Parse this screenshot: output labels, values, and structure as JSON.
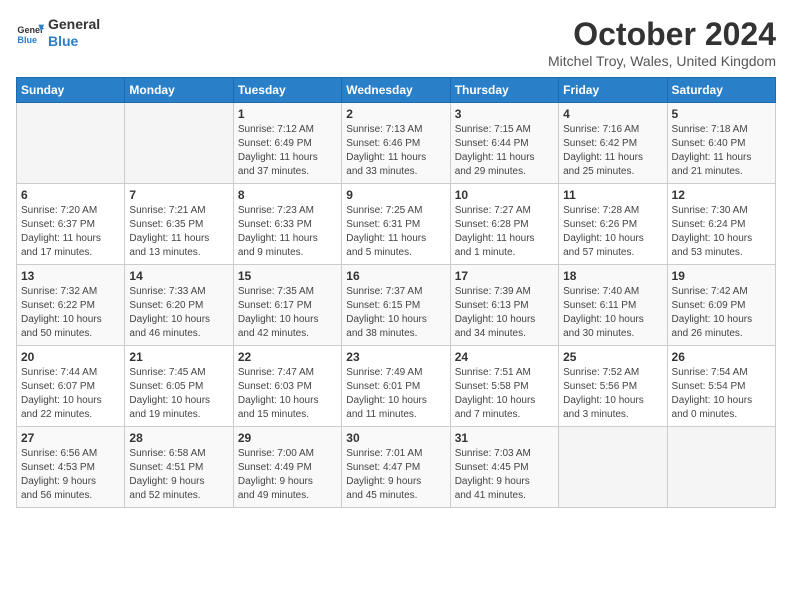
{
  "logo": {
    "line1": "General",
    "line2": "Blue"
  },
  "title": "October 2024",
  "subtitle": "Mitchel Troy, Wales, United Kingdom",
  "weekdays": [
    "Sunday",
    "Monday",
    "Tuesday",
    "Wednesday",
    "Thursday",
    "Friday",
    "Saturday"
  ],
  "weeks": [
    [
      {
        "day": "",
        "info": ""
      },
      {
        "day": "",
        "info": ""
      },
      {
        "day": "1",
        "info": "Sunrise: 7:12 AM\nSunset: 6:49 PM\nDaylight: 11 hours\nand 37 minutes."
      },
      {
        "day": "2",
        "info": "Sunrise: 7:13 AM\nSunset: 6:46 PM\nDaylight: 11 hours\nand 33 minutes."
      },
      {
        "day": "3",
        "info": "Sunrise: 7:15 AM\nSunset: 6:44 PM\nDaylight: 11 hours\nand 29 minutes."
      },
      {
        "day": "4",
        "info": "Sunrise: 7:16 AM\nSunset: 6:42 PM\nDaylight: 11 hours\nand 25 minutes."
      },
      {
        "day": "5",
        "info": "Sunrise: 7:18 AM\nSunset: 6:40 PM\nDaylight: 11 hours\nand 21 minutes."
      }
    ],
    [
      {
        "day": "6",
        "info": "Sunrise: 7:20 AM\nSunset: 6:37 PM\nDaylight: 11 hours\nand 17 minutes."
      },
      {
        "day": "7",
        "info": "Sunrise: 7:21 AM\nSunset: 6:35 PM\nDaylight: 11 hours\nand 13 minutes."
      },
      {
        "day": "8",
        "info": "Sunrise: 7:23 AM\nSunset: 6:33 PM\nDaylight: 11 hours\nand 9 minutes."
      },
      {
        "day": "9",
        "info": "Sunrise: 7:25 AM\nSunset: 6:31 PM\nDaylight: 11 hours\nand 5 minutes."
      },
      {
        "day": "10",
        "info": "Sunrise: 7:27 AM\nSunset: 6:28 PM\nDaylight: 11 hours\nand 1 minute."
      },
      {
        "day": "11",
        "info": "Sunrise: 7:28 AM\nSunset: 6:26 PM\nDaylight: 10 hours\nand 57 minutes."
      },
      {
        "day": "12",
        "info": "Sunrise: 7:30 AM\nSunset: 6:24 PM\nDaylight: 10 hours\nand 53 minutes."
      }
    ],
    [
      {
        "day": "13",
        "info": "Sunrise: 7:32 AM\nSunset: 6:22 PM\nDaylight: 10 hours\nand 50 minutes."
      },
      {
        "day": "14",
        "info": "Sunrise: 7:33 AM\nSunset: 6:20 PM\nDaylight: 10 hours\nand 46 minutes."
      },
      {
        "day": "15",
        "info": "Sunrise: 7:35 AM\nSunset: 6:17 PM\nDaylight: 10 hours\nand 42 minutes."
      },
      {
        "day": "16",
        "info": "Sunrise: 7:37 AM\nSunset: 6:15 PM\nDaylight: 10 hours\nand 38 minutes."
      },
      {
        "day": "17",
        "info": "Sunrise: 7:39 AM\nSunset: 6:13 PM\nDaylight: 10 hours\nand 34 minutes."
      },
      {
        "day": "18",
        "info": "Sunrise: 7:40 AM\nSunset: 6:11 PM\nDaylight: 10 hours\nand 30 minutes."
      },
      {
        "day": "19",
        "info": "Sunrise: 7:42 AM\nSunset: 6:09 PM\nDaylight: 10 hours\nand 26 minutes."
      }
    ],
    [
      {
        "day": "20",
        "info": "Sunrise: 7:44 AM\nSunset: 6:07 PM\nDaylight: 10 hours\nand 22 minutes."
      },
      {
        "day": "21",
        "info": "Sunrise: 7:45 AM\nSunset: 6:05 PM\nDaylight: 10 hours\nand 19 minutes."
      },
      {
        "day": "22",
        "info": "Sunrise: 7:47 AM\nSunset: 6:03 PM\nDaylight: 10 hours\nand 15 minutes."
      },
      {
        "day": "23",
        "info": "Sunrise: 7:49 AM\nSunset: 6:01 PM\nDaylight: 10 hours\nand 11 minutes."
      },
      {
        "day": "24",
        "info": "Sunrise: 7:51 AM\nSunset: 5:58 PM\nDaylight: 10 hours\nand 7 minutes."
      },
      {
        "day": "25",
        "info": "Sunrise: 7:52 AM\nSunset: 5:56 PM\nDaylight: 10 hours\nand 3 minutes."
      },
      {
        "day": "26",
        "info": "Sunrise: 7:54 AM\nSunset: 5:54 PM\nDaylight: 10 hours\nand 0 minutes."
      }
    ],
    [
      {
        "day": "27",
        "info": "Sunrise: 6:56 AM\nSunset: 4:53 PM\nDaylight: 9 hours\nand 56 minutes."
      },
      {
        "day": "28",
        "info": "Sunrise: 6:58 AM\nSunset: 4:51 PM\nDaylight: 9 hours\nand 52 minutes."
      },
      {
        "day": "29",
        "info": "Sunrise: 7:00 AM\nSunset: 4:49 PM\nDaylight: 9 hours\nand 49 minutes."
      },
      {
        "day": "30",
        "info": "Sunrise: 7:01 AM\nSunset: 4:47 PM\nDaylight: 9 hours\nand 45 minutes."
      },
      {
        "day": "31",
        "info": "Sunrise: 7:03 AM\nSunset: 4:45 PM\nDaylight: 9 hours\nand 41 minutes."
      },
      {
        "day": "",
        "info": ""
      },
      {
        "day": "",
        "info": ""
      }
    ]
  ]
}
